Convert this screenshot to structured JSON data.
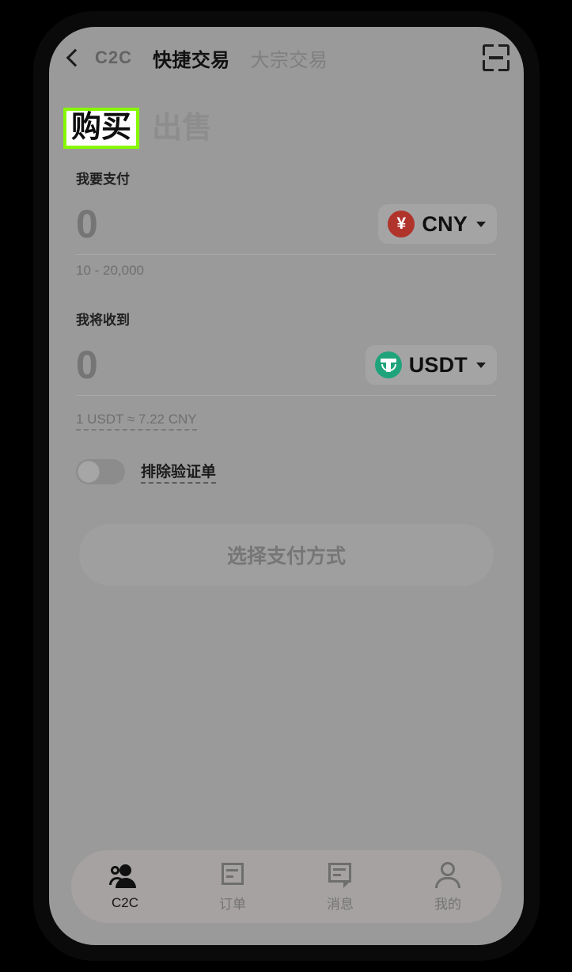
{
  "header": {
    "back_icon": "back-chevron-icon",
    "brand": "C2C",
    "tab_quick": "快捷交易",
    "tab_block": "大宗交易",
    "scan_icon": "scan-icon"
  },
  "trade_tabs": {
    "buy": "购买",
    "sell": "出售",
    "highlight_color": "#86f900"
  },
  "pay_section": {
    "label": "我要支付",
    "value": "0",
    "placeholder": "0",
    "currency_symbol": "¥",
    "currency_code": "CNY",
    "currency_color": "#b0332c",
    "limit_hint": "10 - 20,000"
  },
  "receive_section": {
    "label": "我将收到",
    "value": "0",
    "placeholder": "0",
    "currency_symbol": "₮",
    "currency_code": "USDT",
    "currency_color": "#1fa37a",
    "rate_hint": "1 USDT ≈ 7.22 CNY"
  },
  "options": {
    "exclude_verified_label": "排除验证单",
    "exclude_verified_on": false
  },
  "cta": {
    "label": "选择支付方式",
    "enabled": false
  },
  "bottom_nav": {
    "items": [
      {
        "label": "C2C",
        "icon": "people-icon",
        "active": true
      },
      {
        "label": "订单",
        "icon": "document-icon",
        "active": false
      },
      {
        "label": "消息",
        "icon": "chat-bubble-icon",
        "active": false
      },
      {
        "label": "我的",
        "icon": "person-icon",
        "active": false
      }
    ]
  }
}
